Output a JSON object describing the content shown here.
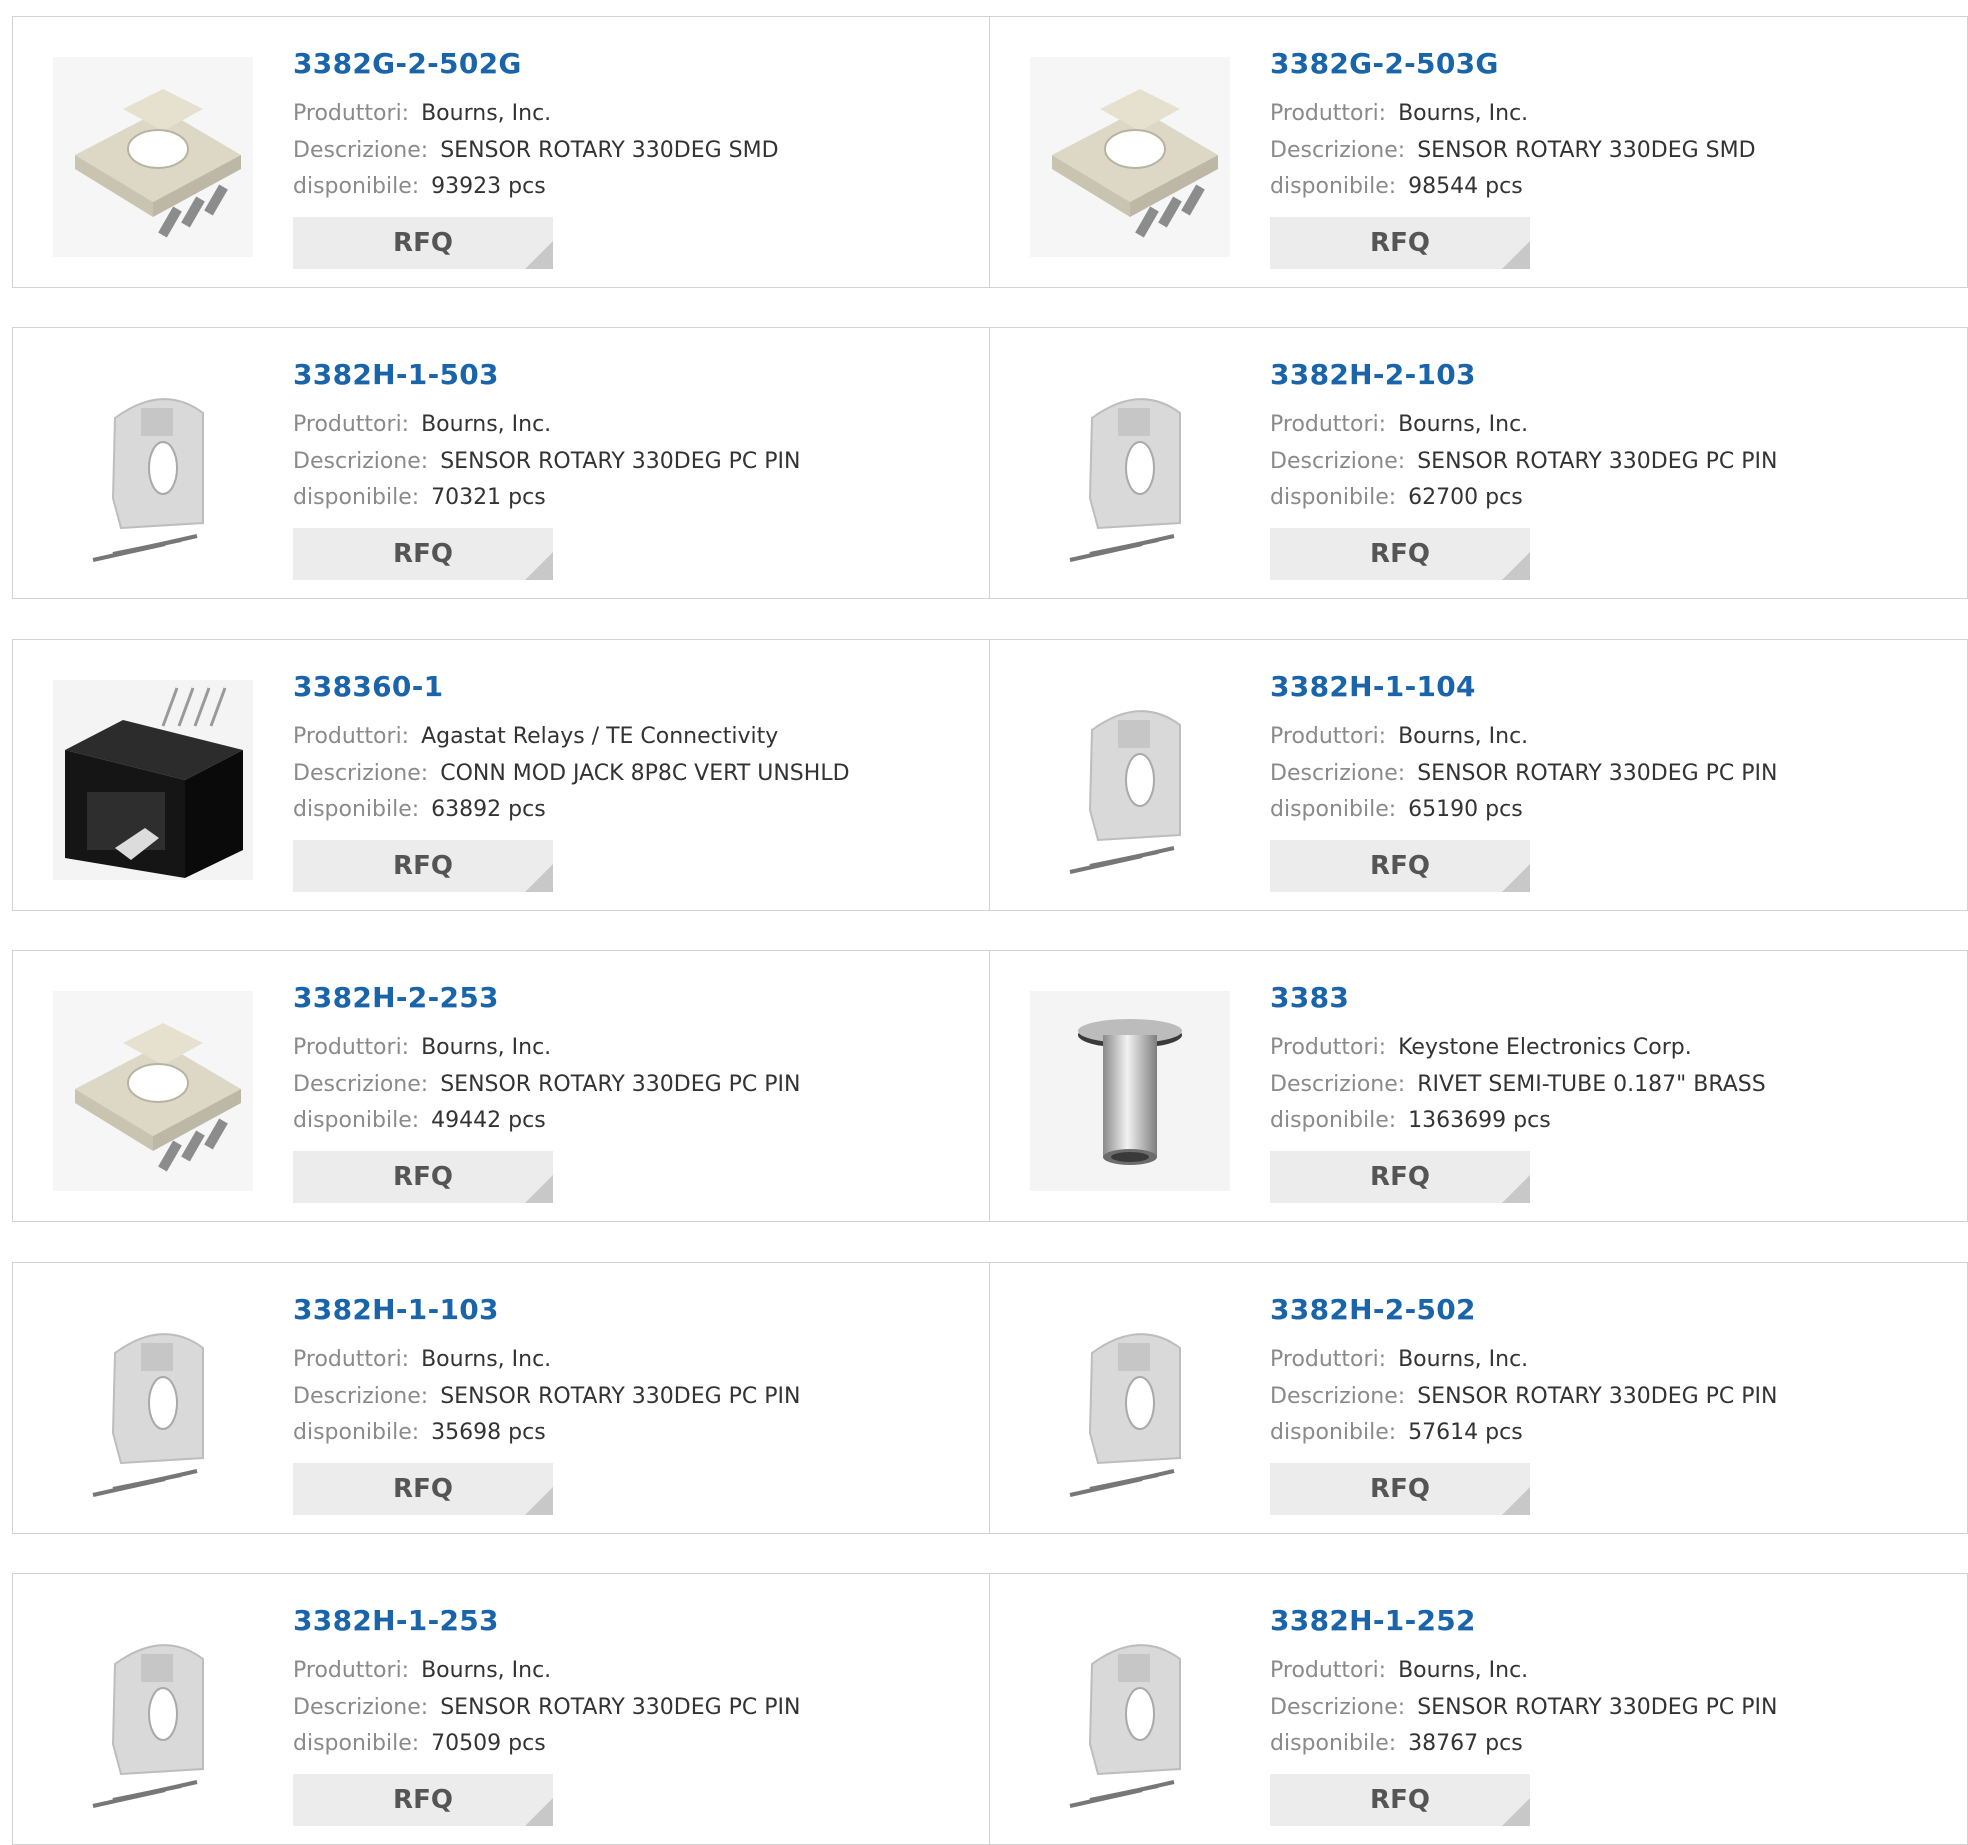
{
  "labels": {
    "manufacturer": "Produttori:",
    "description": "Descrizione:",
    "available": "disponibile:",
    "rfq": "RFQ"
  },
  "colors": {
    "part_link": "#1a64aa",
    "label_gray": "#8a8a8a",
    "button_bg": "#ececec",
    "border": "#d2d2d2"
  },
  "products": [
    {
      "part": "3382G-2-502G",
      "manufacturer": "Bourns, Inc.",
      "description": "SENSOR ROTARY 330DEG SMD",
      "stock": "93923 pcs",
      "image": "smd-rotary-sensor-image"
    },
    {
      "part": "3382G-2-503G",
      "manufacturer": "Bourns, Inc.",
      "description": "SENSOR ROTARY 330DEG SMD",
      "stock": "98544 pcs",
      "image": "smd-rotary-sensor-image"
    },
    {
      "part": "3382H-1-503",
      "manufacturer": "Bourns, Inc.",
      "description": "SENSOR ROTARY 330DEG PC PIN",
      "stock": "70321 pcs",
      "image": "pc-pin-rotary-sensor-image"
    },
    {
      "part": "3382H-2-103",
      "manufacturer": "Bourns, Inc.",
      "description": "SENSOR ROTARY 330DEG PC PIN",
      "stock": "62700 pcs",
      "image": "pc-pin-rotary-sensor-image"
    },
    {
      "part": "338360-1",
      "manufacturer": "Agastat Relays / TE Connectivity",
      "description": "CONN MOD JACK 8P8C VERT UNSHLD",
      "stock": "63892 pcs",
      "image": "modular-jack-image"
    },
    {
      "part": "3382H-1-104",
      "manufacturer": "Bourns, Inc.",
      "description": "SENSOR ROTARY 330DEG PC PIN",
      "stock": "65190 pcs",
      "image": "pc-pin-rotary-sensor-image"
    },
    {
      "part": "3382H-2-253",
      "manufacturer": "Bourns, Inc.",
      "description": "SENSOR ROTARY 330DEG PC PIN",
      "stock": "49442 pcs",
      "image": "smd-rotary-sensor-image"
    },
    {
      "part": "3383",
      "manufacturer": "Keystone Electronics Corp.",
      "description": "RIVET SEMI-TUBE 0.187\" BRASS",
      "stock": "1363699 pcs",
      "image": "rivet-image"
    },
    {
      "part": "3382H-1-103",
      "manufacturer": "Bourns, Inc.",
      "description": "SENSOR ROTARY 330DEG PC PIN",
      "stock": "35698 pcs",
      "image": "pc-pin-rotary-sensor-image"
    },
    {
      "part": "3382H-2-502",
      "manufacturer": "Bourns, Inc.",
      "description": "SENSOR ROTARY 330DEG PC PIN",
      "stock": "57614 pcs",
      "image": "pc-pin-rotary-sensor-image"
    },
    {
      "part": "3382H-1-253",
      "manufacturer": "Bourns, Inc.",
      "description": "SENSOR ROTARY 330DEG PC PIN",
      "stock": "70509 pcs",
      "image": "pc-pin-rotary-sensor-image"
    },
    {
      "part": "3382H-1-252",
      "manufacturer": "Bourns, Inc.",
      "description": "SENSOR ROTARY 330DEG PC PIN",
      "stock": "38767 pcs",
      "image": "pc-pin-rotary-sensor-image"
    }
  ]
}
